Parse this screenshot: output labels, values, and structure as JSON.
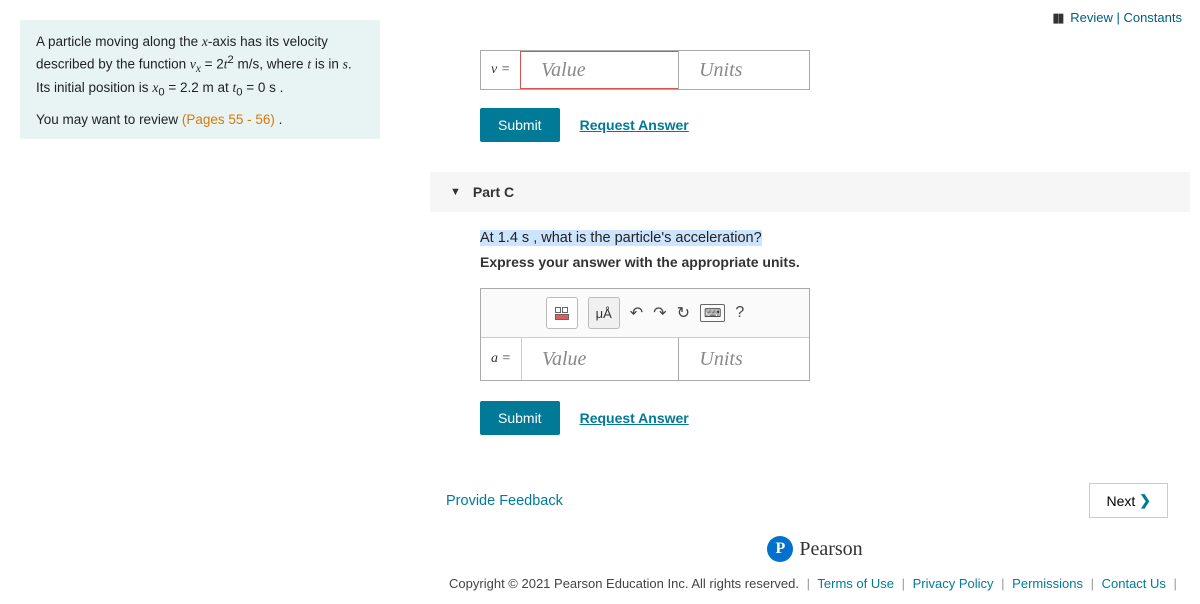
{
  "topLinks": {
    "review": "Review",
    "constants": "Constants"
  },
  "problem": {
    "line1a": "A particle moving along the ",
    "line1b": "x",
    "line1c": "-axis has its velocity described by the function ",
    "vx": "v",
    "vxsub": "x",
    "eq": " = 2",
    "t": "t",
    "sq": "2",
    "units1": " m/s, where ",
    "tvar": "t",
    "line2a": " is in ",
    "s": "s",
    "line2b": ". Its initial position is ",
    "x0": "x",
    "x0sub": "0",
    "eq2": " = 2.2 m at ",
    "t0": "t",
    "t0sub": "0",
    "eq3": " = 0 s .",
    "reviewText": "You may want to review ",
    "pagesLink": "(Pages 55 - 56)",
    "period": " ."
  },
  "partB": {
    "label": "v =",
    "valuePlaceholder": "Value",
    "unitsPlaceholder": "Units",
    "submit": "Submit",
    "request": "Request Answer"
  },
  "partC": {
    "header": "Part C",
    "q1": "At 1.4 s ",
    "q2": ", what is the particle's acceleration?",
    "instruction": "Express your answer with the appropriate units.",
    "muA": "μÅ",
    "help": "?",
    "label": "a =",
    "valuePlaceholder": "Value",
    "unitsPlaceholder": "Units",
    "submit": "Submit",
    "request": "Request Answer"
  },
  "feedback": "Provide Feedback",
  "next": "Next",
  "pearson": "Pearson",
  "footer": {
    "copyright": "Copyright © 2021 Pearson Education Inc. All rights reserved.",
    "terms": "Terms of Use",
    "privacy": "Privacy Policy",
    "permissions": "Permissions",
    "contact": "Contact Us"
  }
}
